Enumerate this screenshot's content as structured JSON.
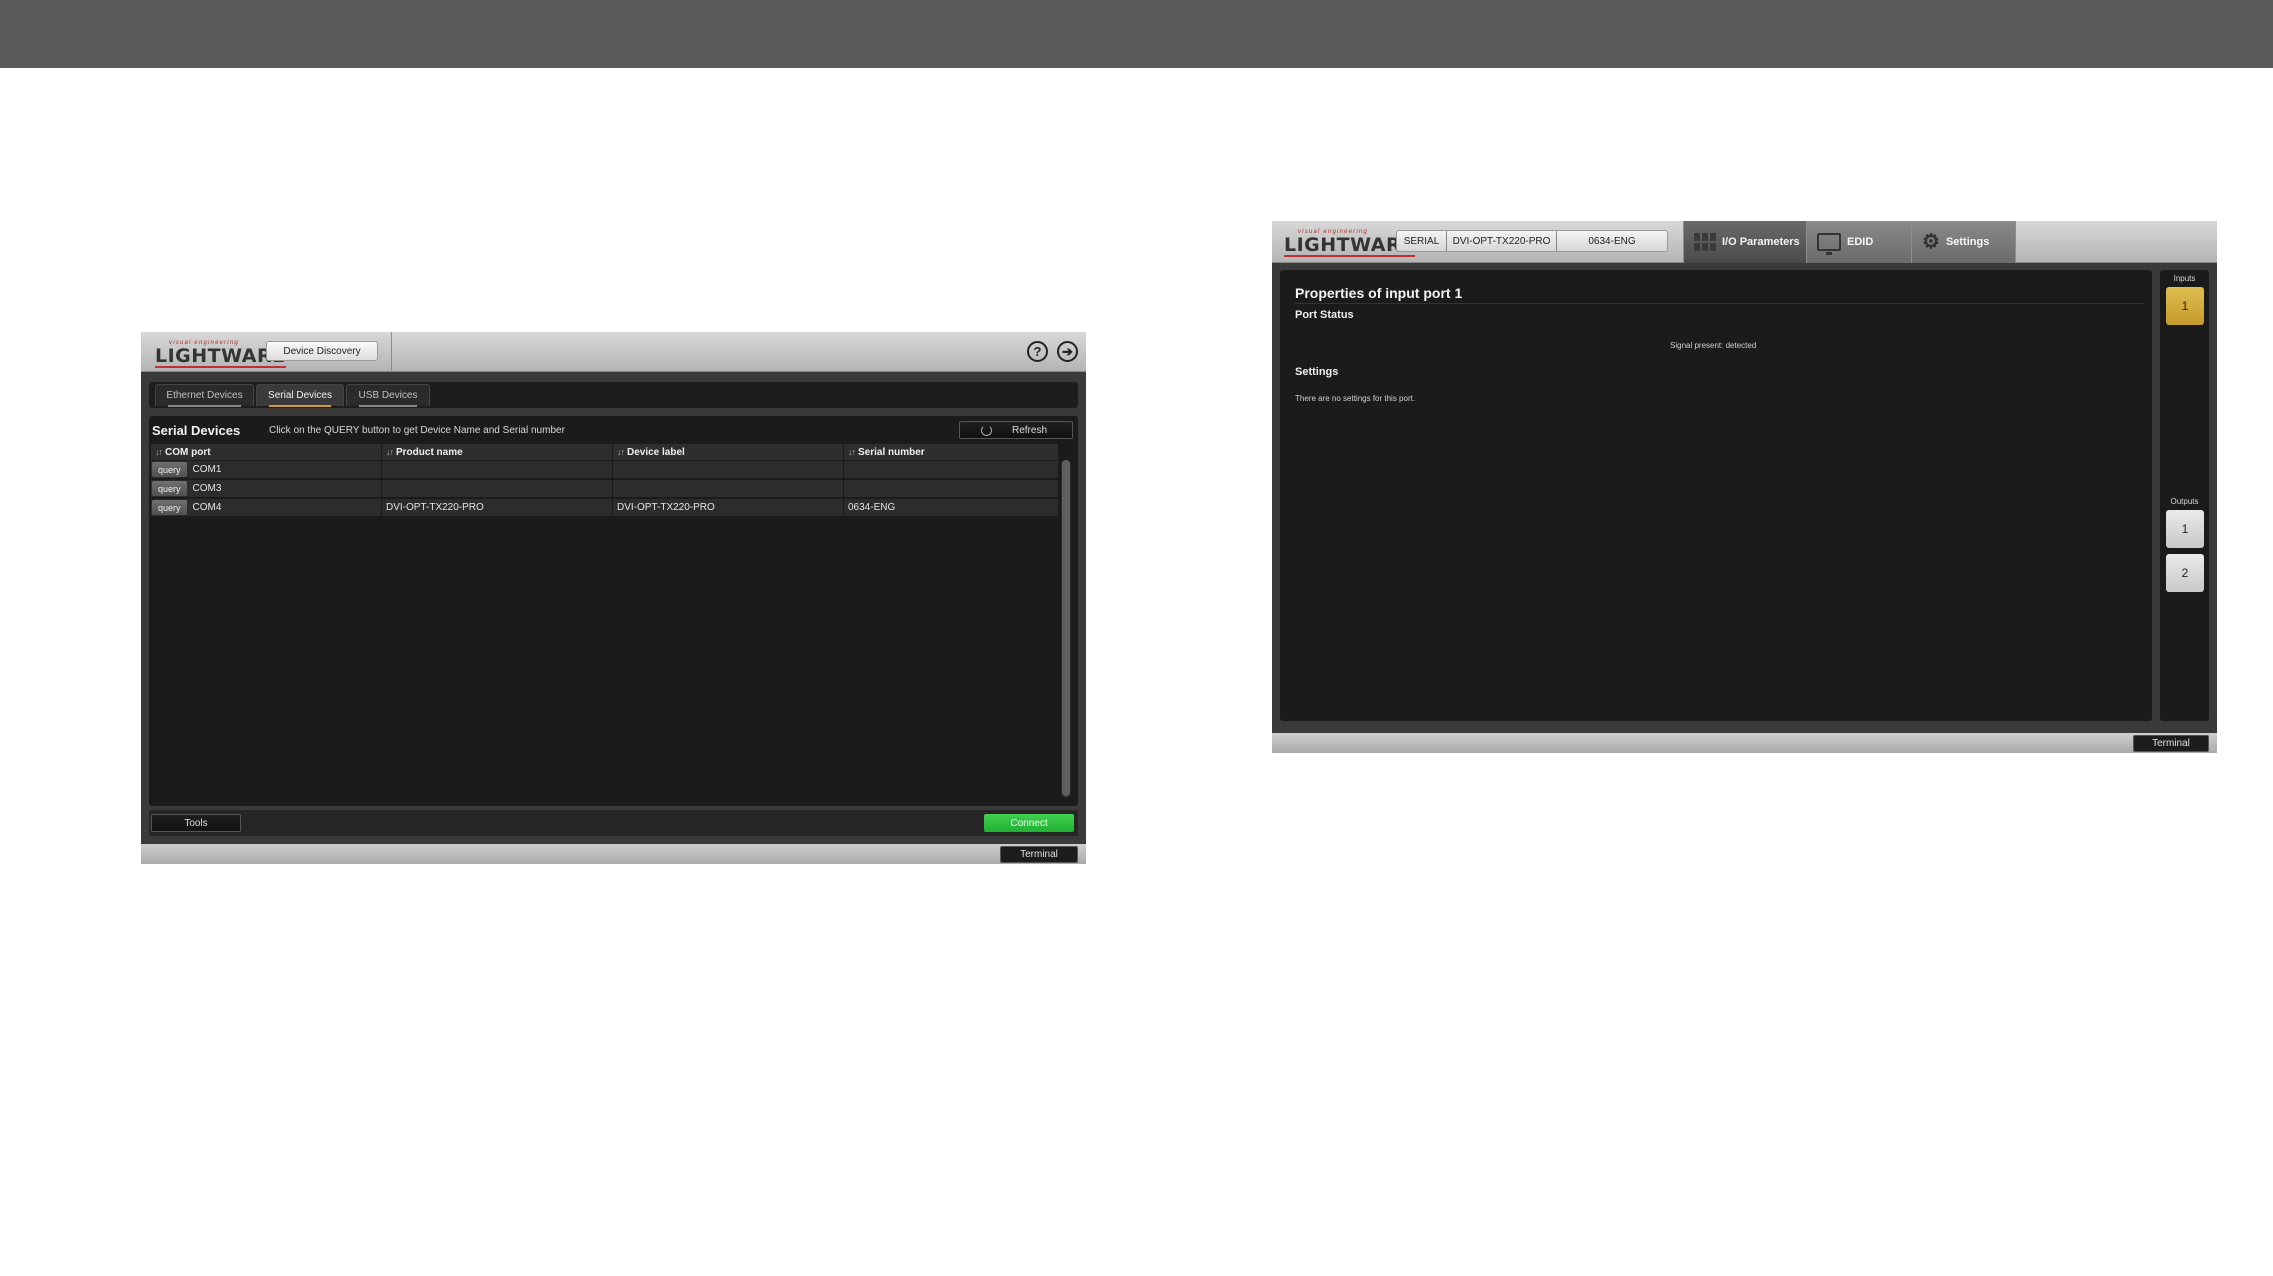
{
  "left_app": {
    "logo": {
      "small": "visual engineering",
      "main": "LIGHTWARE"
    },
    "device_discovery_label": "Device Discovery",
    "help_icon_glyph": "?",
    "exit_icon_glyph": "➔",
    "tabs": [
      {
        "label": "Ethernet Devices",
        "active": false
      },
      {
        "label": "Serial Devices",
        "active": true
      },
      {
        "label": "USB Devices",
        "active": false
      }
    ],
    "panel_title": "Serial Devices",
    "panel_hint": "Click on the QUERY button to get Device Name and Serial number",
    "refresh_label": "Refresh",
    "table": {
      "headers": [
        "COM port",
        "Product name",
        "Device label",
        "Serial number"
      ],
      "sort_icon": "↓↑",
      "query_label": "query",
      "rows": [
        {
          "com": "COM1",
          "product": "",
          "label": "",
          "serial": ""
        },
        {
          "com": "COM3",
          "product": "",
          "label": "",
          "serial": ""
        },
        {
          "com": "COM4",
          "product": "DVI-OPT-TX220-PRO",
          "label": "DVI-OPT-TX220-PRO",
          "serial": "0634-ENG"
        }
      ]
    },
    "tools_label": "Tools",
    "connect_label": "Connect",
    "terminal_label": "Terminal"
  },
  "right_app": {
    "logo": {
      "small": "visual engineering",
      "main": "LIGHTWARE"
    },
    "device_info": {
      "connection": "SERIAL",
      "product": "DVI-OPT-TX220-PRO",
      "serial": "0634-ENG"
    },
    "nav": {
      "io": "I/O Parameters",
      "edid": "EDID",
      "settings": "Settings"
    },
    "gear_glyph": "⚙",
    "properties_title": "Properties of input port 1",
    "port_status_heading": "Port Status",
    "signal_text": "Signal present: detected",
    "settings_heading": "Settings",
    "no_settings_text": "There are no settings for this port.",
    "inputs_label": "Inputs",
    "inputs": [
      "1"
    ],
    "outputs_label": "Outputs",
    "outputs": [
      "1",
      "2"
    ],
    "terminal_label": "Terminal"
  },
  "colors": {
    "header_bar": "#5a5a5a",
    "app_background": "#3a3a3a",
    "panel_background": "#1b1b1b",
    "active_tab_underline": "#d0a020",
    "connect_green": "#2ec040",
    "selected_input": "#d4ab3c",
    "brand_red": "#c03030"
  }
}
